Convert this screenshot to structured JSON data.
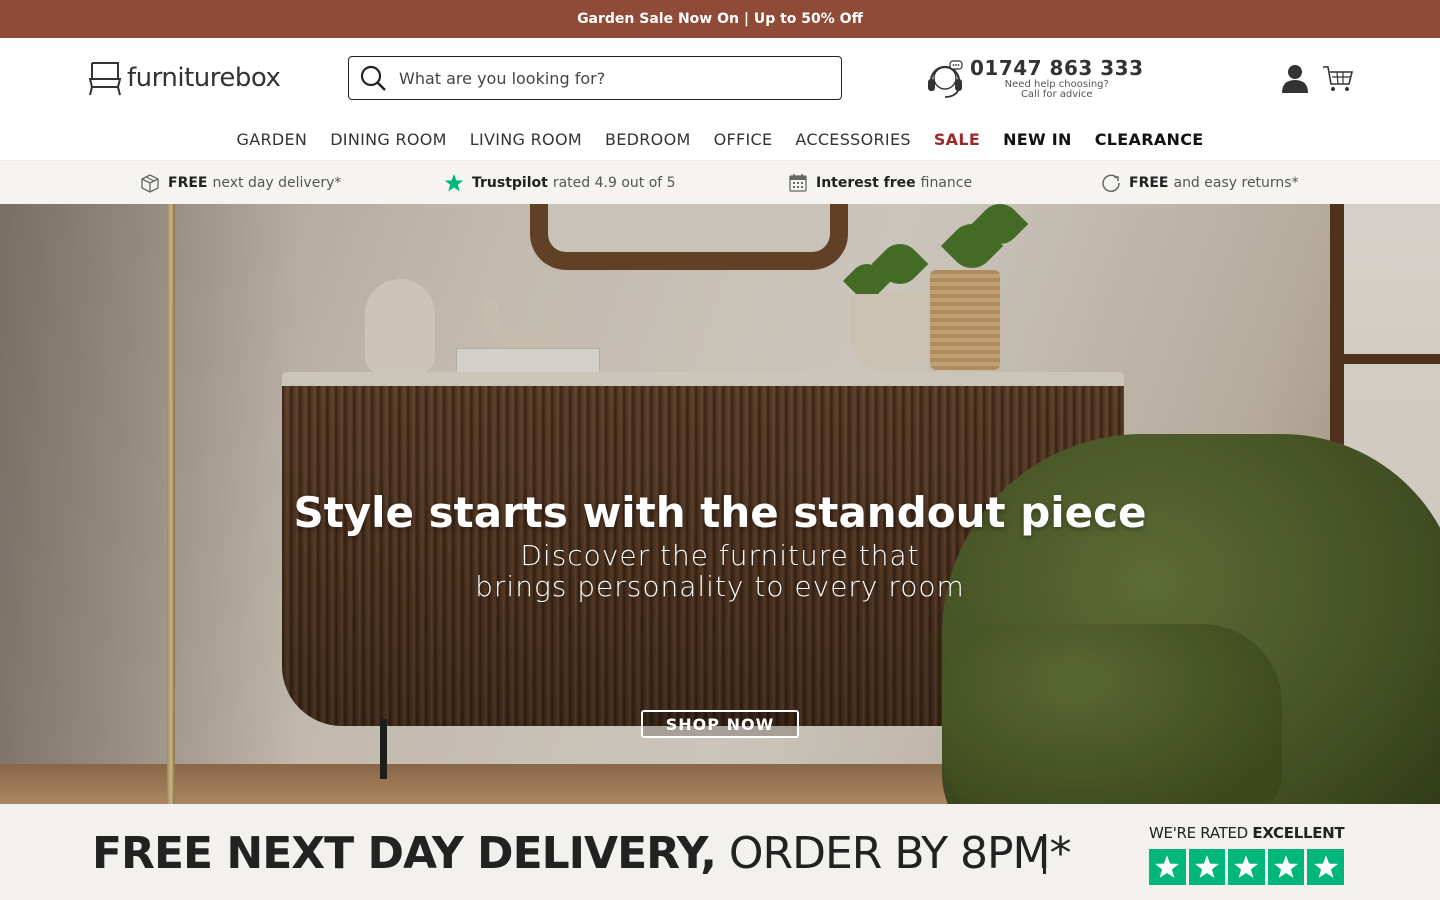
{
  "promo": {
    "text": "Garden Sale Now On | Up to 50% Off"
  },
  "header": {
    "logo_text": "furniturebox",
    "search_placeholder": "What are you looking for?",
    "phone_number": "01747 863 333",
    "phone_sub1": "Need help choosing?",
    "phone_sub2": "Call for advice"
  },
  "nav": {
    "items": [
      {
        "label": "GARDEN"
      },
      {
        "label": "DINING ROOM"
      },
      {
        "label": "LIVING ROOM"
      },
      {
        "label": "BEDROOM"
      },
      {
        "label": "OFFICE"
      },
      {
        "label": "ACCESSORIES"
      },
      {
        "label": "SALE"
      },
      {
        "label": "NEW IN"
      },
      {
        "label": "CLEARANCE"
      }
    ]
  },
  "usp": {
    "delivery_bold": "FREE",
    "delivery_rest": "next day delivery*",
    "trust_bold": "Trustpilot",
    "trust_rest": "rated 4.9 out of 5",
    "finance_bold": "Interest free",
    "finance_rest": "finance",
    "returns_bold": "FREE",
    "returns_rest": "and easy returns*"
  },
  "hero": {
    "title": "Style starts with the standout piece",
    "subtitle": "Discover the furniture that brings personality to every room",
    "cta": "SHOP NOW"
  },
  "banner": {
    "bold_text": "FREE NEXT DAY DELIVERY,",
    "thin_text": "ORDER BY 8PM*",
    "rated_prefix": "WE'RE RATED",
    "rated_bold": "EXCELLENT",
    "stars": 5
  },
  "colors": {
    "promo_bg": "#8f4a38",
    "sale": "#9b2a2a",
    "trustpilot": "#00b67a"
  }
}
